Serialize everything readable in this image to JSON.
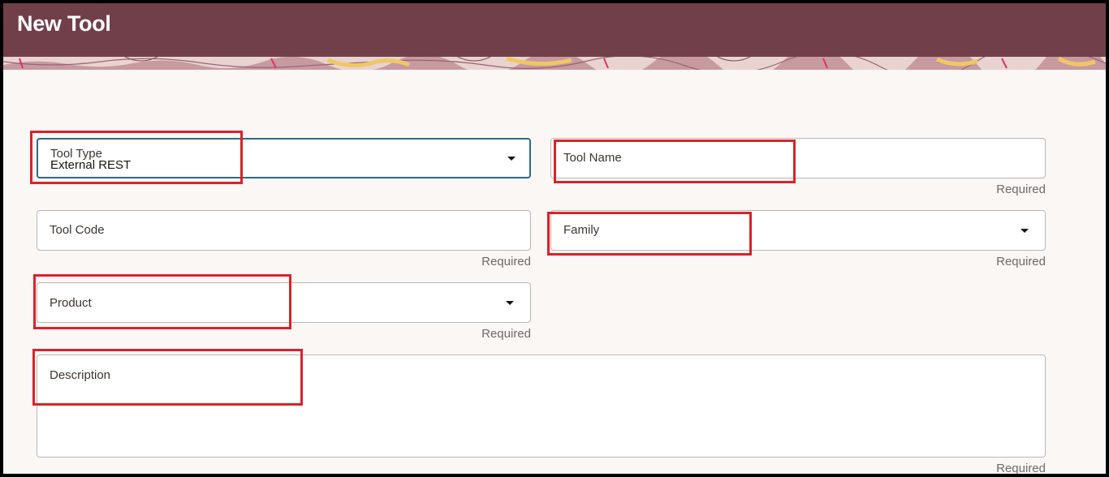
{
  "header": {
    "title": "New Tool"
  },
  "form": {
    "tool_type": {
      "label": "Tool Type",
      "value": "External REST"
    },
    "tool_name": {
      "label": "Tool Name",
      "required": "Required"
    },
    "tool_code": {
      "label": "Tool Code",
      "required": "Required"
    },
    "family": {
      "label": "Family",
      "required": "Required"
    },
    "product": {
      "label": "Product",
      "required": "Required"
    },
    "description": {
      "label": "Description",
      "required": "Required"
    }
  },
  "colors": {
    "header_bg": "#703f4a",
    "annotation_red": "#d8232a",
    "focus_border": "#2c6b82",
    "page_bg": "#faf7f5"
  },
  "icons": [
    "dropdown-caret-icon"
  ]
}
